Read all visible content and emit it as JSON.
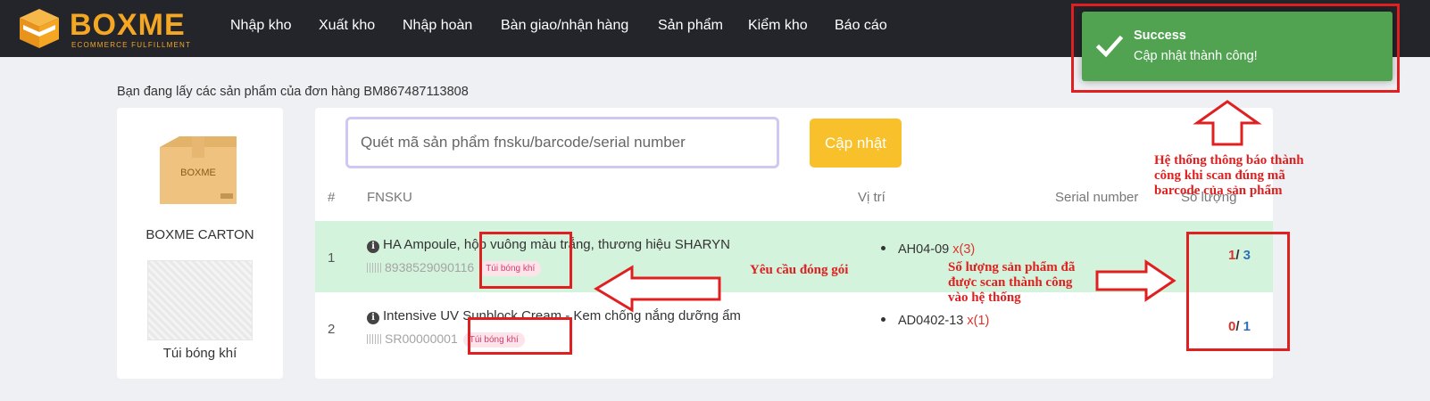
{
  "brand": {
    "name": "BOXME",
    "tagline": "ECOMMERCE FULFILLMENT",
    "logo_text": "BOXME",
    "primary_color": "#f5a623"
  },
  "nav": {
    "items": [
      {
        "label": "Nhập kho"
      },
      {
        "label": "Xuất kho"
      },
      {
        "label": "Nhập hoàn"
      },
      {
        "label": "Bàn giao/nhận hàng"
      },
      {
        "label": "Sản phẩm"
      },
      {
        "label": "Kiểm kho"
      },
      {
        "label": "Báo cáo"
      }
    ]
  },
  "order": {
    "heading": "Bạn đang lấy các sản phẩm của đơn hàng BM867487113808"
  },
  "packaging": {
    "carton": {
      "name": "BOXME CARTON",
      "image_label": "BOXME"
    },
    "bag": {
      "name": "Túi bóng khí"
    }
  },
  "scan": {
    "placeholder": "Quét mã sản phẩm fnsku/barcode/serial number",
    "button_label": "Cập nhật",
    "button_color": "#f8c02a"
  },
  "table": {
    "headers": {
      "index": "#",
      "fnsku": "FNSKU",
      "location": "Vị trí",
      "serial": "Serial number",
      "quantity": "Số lượng"
    },
    "rows": [
      {
        "index": "1",
        "name": "HA Ampoule, hộp vuông màu trắng, thương hiệu SHARYN",
        "code": "8938529090116",
        "tag": "Túi bóng khí",
        "location": "AH04-09",
        "location_qty": "x(3)",
        "scanned": "1",
        "total": "3",
        "highlight_color": "#d4f3dc"
      },
      {
        "index": "2",
        "name": "Intensive UV Sunblock Cream - Kem chống nắng dưỡng ẩm",
        "code": "SR00000001",
        "tag": "Túi bóng khí",
        "location": "AD0402-13",
        "location_qty": "x(1)",
        "scanned": "0",
        "total": "1"
      }
    ]
  },
  "toast": {
    "title": "Success",
    "message": "Cập nhật thành công!",
    "color": "#51a351",
    "icon": "check-icon"
  },
  "annotations": {
    "toast_note": "Hệ thống thông báo thành công khi scan đúng mã barcode của sản phẩm",
    "packing_note": "Yêu cầu đóng gói",
    "qty_note": "Số lượng sản phẩm đã được scan thành công vào hệ thống",
    "color": "#e02020"
  }
}
